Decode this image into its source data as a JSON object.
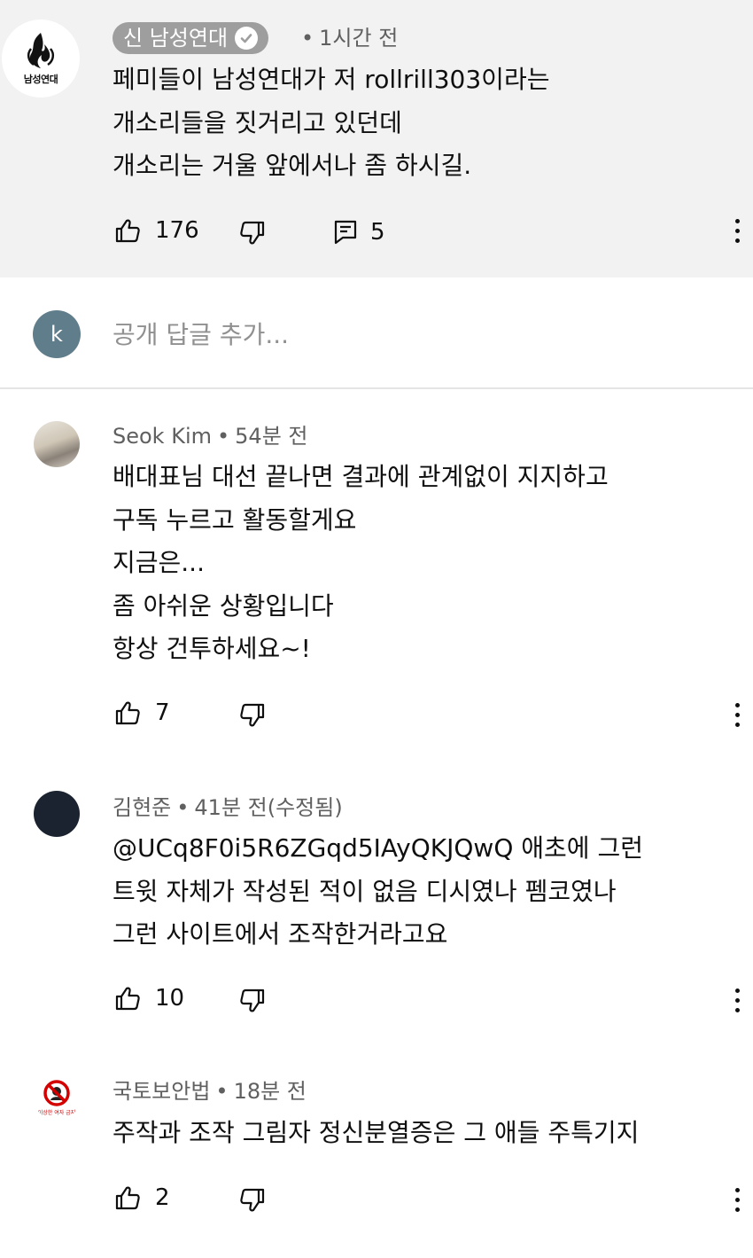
{
  "top_comment": {
    "author": "신 남성연대",
    "logo_text": "남성연대",
    "time": "1시간 전",
    "text": "페미들이 남성연대가 저 rollrill303이라는\n개소리들을 짓거리고 있던데\n개소리는 거울 앞에서나 좀 하시길.",
    "likes": "176",
    "replies": "5"
  },
  "reply_input": {
    "avatar_letter": "k",
    "placeholder": "공개 답글 추가..."
  },
  "replies": [
    {
      "author": "Seok Kim",
      "time": "54분 전",
      "text": "배대표님 대선 끝나면 결과에 관계없이 지지하고\n구독 누르고 활동할게요\n지금은...\n좀 아쉬운 상황입니다\n항상 건투하세요~!",
      "likes": "7"
    },
    {
      "author": "김현준",
      "time": "41분 전(수정됨)",
      "text": "@UCq8F0i5R6ZGqd5IAyQKJQwQ 애초에 그런\n트윗 자체가 작성된 적이 없음 디시였나 펨코였나\n그런 사이트에서 조작한거라고요",
      "likes": "10"
    },
    {
      "author": "국토보안법",
      "avatar_caption": "이상한 여자 금지",
      "time": "18분 전",
      "text": "주작과 조작 그림자 정신분열증은 그 애들 주특기지",
      "likes": "2"
    }
  ],
  "meta_separator": "•",
  "icons": {
    "like": "thumbs-up-icon",
    "dislike": "thumbs-down-icon",
    "reply": "comment-icon",
    "more": "more-vert-icon",
    "verified": "verified-check-icon"
  },
  "colors": {
    "top_background": "#f2f2f2",
    "chip_background": "#9e9e9e",
    "meta_text": "#606060",
    "k_avatar": "#607d8b"
  }
}
